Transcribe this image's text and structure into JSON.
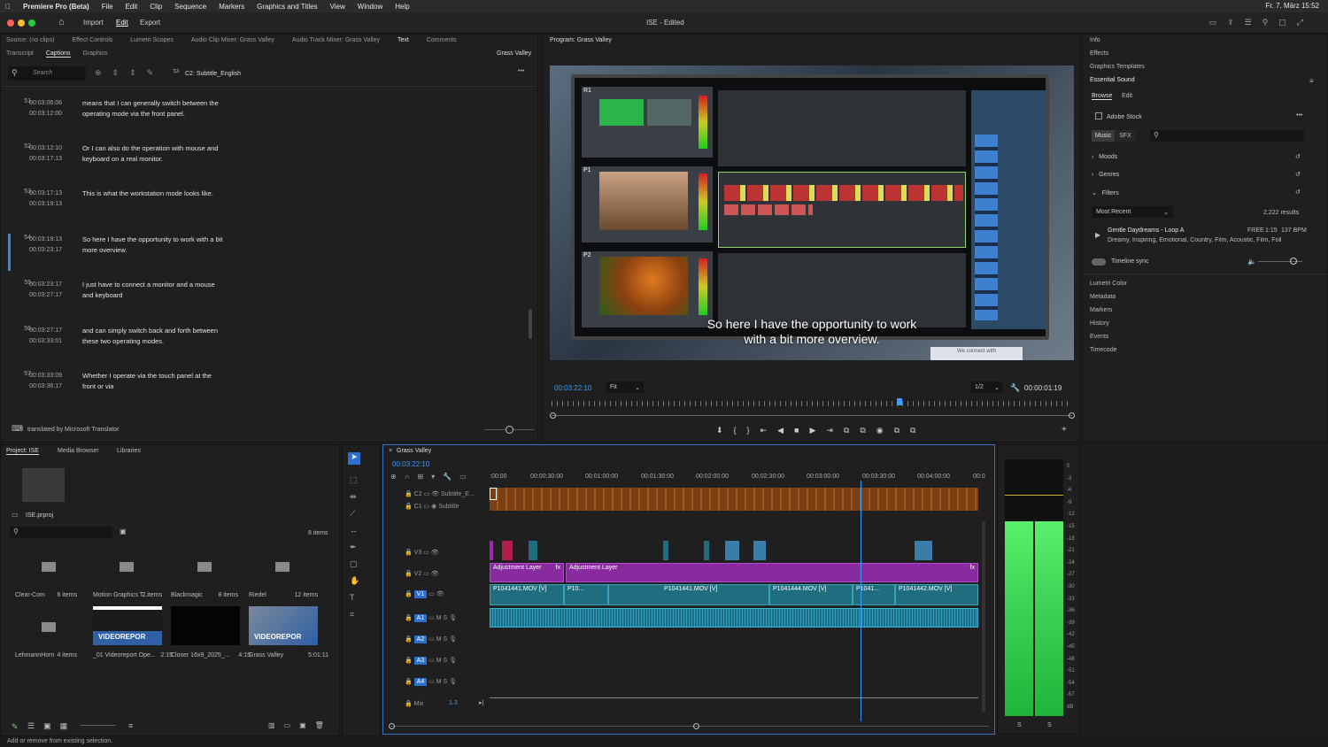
{
  "menubar": {
    "app": "Premiere Pro (Beta)",
    "items": [
      "File",
      "Edit",
      "Clip",
      "Sequence",
      "Markers",
      "Graphics and Titles",
      "View",
      "Window",
      "Help"
    ],
    "clock": "Fr. 7. März 15:52"
  },
  "titlebar": {
    "title": "ISE - Edited",
    "import": "Import",
    "edit": "Edit",
    "export": "Export"
  },
  "source_tabs": [
    "Source: (no clips)",
    "Effect Controls",
    "Lumetri Scopes",
    "Audio Clip Mixer: Grass Valley",
    "Audio Track Mixer: Grass Valley",
    "Text",
    "Comments"
  ],
  "text_subtabs": [
    "Transcript",
    "Captions",
    "Graphics"
  ],
  "sequence_name": "Grass Valley",
  "captions": {
    "search_placeholder": "Search",
    "track": "C2: Subtitle_English",
    "footer": "translated by Microsoft Translator",
    "rows": [
      {
        "num": "51.",
        "in": "00:03:06:06",
        "out": "00:03:12:00",
        "text": "means that I can generally switch between the operating mode via the front panel."
      },
      {
        "num": "52.",
        "in": "00:03:12:10",
        "out": "00:03:17:13",
        "text": "Or I can also do the operation with mouse and keyboard on a real monitor."
      },
      {
        "num": "53.",
        "in": "00:03:17:13",
        "out": "00:03:19:13",
        "text": "This is what the workstation mode looks like."
      },
      {
        "num": "54.",
        "in": "00:03:19:13",
        "out": "00:03:23:17",
        "text": "So here I have the opportunity to work with a bit more overview."
      },
      {
        "num": "55.",
        "in": "00:03:23:17",
        "out": "00:03:27:17",
        "text": "I just have to connect a monitor and a mouse and keyboard"
      },
      {
        "num": "56.",
        "in": "00:03:27:17",
        "out": "00:03:33:01",
        "text": "and can simply switch back and forth between these two operating modes."
      },
      {
        "num": "57.",
        "in": "00:03:33:09",
        "out": "00:03:36:17",
        "text": "Whether I operate via the touch panel at the front or via"
      }
    ]
  },
  "program": {
    "title": "Program: Grass Valley",
    "timecode": "00:03:22:10",
    "fit": "Fit",
    "quality": "1/2",
    "duration": "00:00:01:19",
    "subtitle_line1": "So here I have the opportunity to work",
    "subtitle_line2": "with a bit more overview.",
    "watermark": "We connect with",
    "screen_labels": [
      "R1",
      "P1",
      "P2"
    ]
  },
  "right_panel": {
    "items_top": [
      "Info",
      "Effects",
      "Graphics Templates",
      "Essential Sound"
    ],
    "browse": "Browse",
    "edit": "Edit",
    "adobe_stock": "Adobe Stock",
    "music": "Music",
    "sfx": "SFX",
    "moods": "Moods",
    "genres": "Genres",
    "filters": "Filters",
    "sort": "Most Recent",
    "results": "2,222 results",
    "track_title": "Gentle Daydreams - Loop A",
    "track_free": "FREE",
    "track_len": "1:15",
    "track_bpm": "137 BPM",
    "track_tags": "Dreamy, Inspiring, Emotional, Country, Film, Acoustic, Film, Folk",
    "timeline_sync": "Timeline sync",
    "items_bottom": [
      "Lumetri Color",
      "Metadata",
      "Markers",
      "History",
      "Events",
      "Timecode"
    ]
  },
  "project": {
    "tabs": [
      "Project: ISE",
      "Media Browser",
      "Libraries"
    ],
    "file": "ISE.prproj",
    "count": "8 items",
    "bins": [
      {
        "name": "Clear-Com",
        "info": "6 items"
      },
      {
        "name": "Motion Graphics T...",
        "info": "2 items"
      },
      {
        "name": "Blackmagic",
        "info": "8 items"
      },
      {
        "name": "Riedel",
        "info": "12 items"
      }
    ],
    "clips": [
      {
        "name": "LehmannHorn",
        "info": "4 items"
      },
      {
        "name": "_01 Videoreport Ope...",
        "info": "2:15"
      },
      {
        "name": "Closer 16x9_2025_...",
        "info": "4:15"
      },
      {
        "name": "Grass Valley",
        "info": "5:01:11"
      }
    ],
    "thumb_label": "VIDEOREPOR"
  },
  "timeline": {
    "tab": "Grass Valley",
    "timecode": "00:03:22:10",
    "ruler": [
      ":00:00",
      "00:00:30:00",
      "00:01:00:00",
      "00:01:30:00",
      "00:02:00:00",
      "00:02:30:00",
      "00:03:00:00",
      "00:03:30:00",
      "00:04:00:00",
      "00:0"
    ],
    "tracks": {
      "c2": "C2",
      "c2name": "Subtitle_E...",
      "c1": "C1",
      "c1name": "Subtitle",
      "v3": "V3",
      "v2": "V2",
      "v1": "V1",
      "a1": "A1",
      "a2": "A2",
      "a3": "A3",
      "a4": "A4",
      "mix": "Mix",
      "mixval": "1.3"
    },
    "adjustment": "Adjustment Layer",
    "clips_v1": [
      "P1041441.MOV [V]",
      "P10...",
      "P1041441.MOV [V]",
      "P1041444.MOV [V]",
      "P1041...",
      "P1041442.MOV [V]"
    ],
    "fx": "fx"
  },
  "meter": {
    "scale": [
      "0",
      "-3",
      "-6",
      "-9",
      "-12",
      "-15",
      "-18",
      "-21",
      "-24",
      "-27",
      "-30",
      "-33",
      "-36",
      "-39",
      "-42",
      "-45",
      "-48",
      "-51",
      "-54",
      "-57",
      "dB"
    ],
    "s": "S"
  },
  "status": "Add or remove from existing selection."
}
